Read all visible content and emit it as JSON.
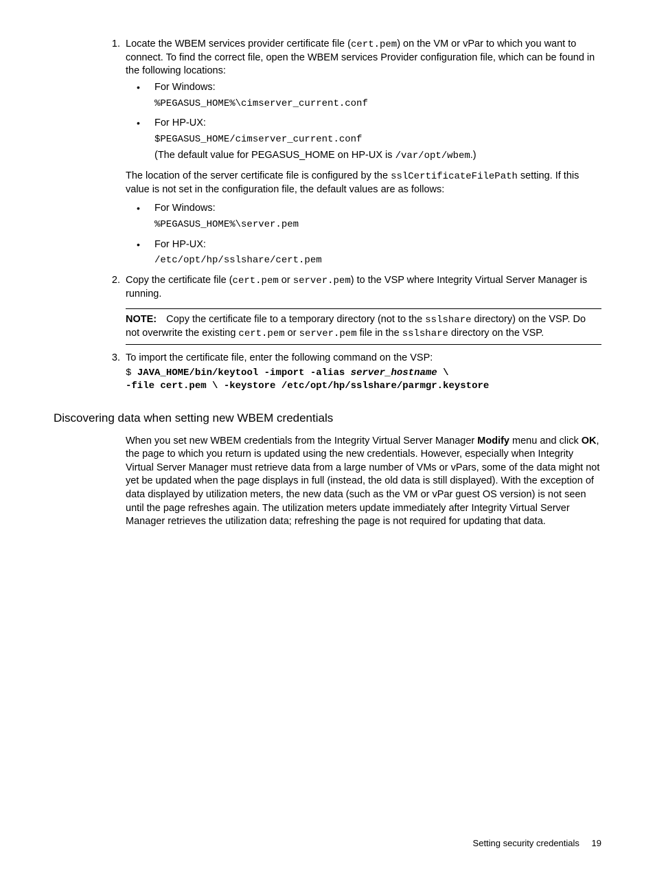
{
  "steps": {
    "s1": {
      "num": "1.",
      "intro_a": "Locate the WBEM services provider certificate file (",
      "intro_code1": "cert.pem",
      "intro_b": ") on the VM or vPar to which you want to connect. To find the correct file, open the WBEM services Provider configuration file, which can be found in the following locations:",
      "b1_label": "For Windows:",
      "b1_code": "%PEGASUS_HOME%\\cimserver_current.conf",
      "b2_label": "For HP-UX:",
      "b2_code": "$PEGASUS_HOME/cimserver_current.conf",
      "b2_extra_a": "(The default value for PEGASUS_HOME on HP-UX is ",
      "b2_extra_code": "/var/opt/wbem",
      "b2_extra_b": ".)",
      "mid_a": "The location of the server certificate file is configured by the ",
      "mid_code": "sslCertificateFilePath",
      "mid_b": " setting. If this value is not set in the configuration file, the default values are as follows:",
      "b3_label": "For Windows:",
      "b3_code": "%PEGASUS_HOME%\\server.pem",
      "b4_label": "For HP-UX:",
      "b4_code": "/etc/opt/hp/sslshare/cert.pem"
    },
    "s2": {
      "num": "2.",
      "intro_a": "Copy the certificate file (",
      "intro_code1": "cert.pem",
      "intro_mid": " or ",
      "intro_code2": "server.pem",
      "intro_b": ") to the VSP where Integrity Virtual Server Manager is running.",
      "note_label": "NOTE:",
      "note_a": "Copy the certificate file to a temporary directory (not to the ",
      "note_code1": "sslshare",
      "note_b": " directory) on the VSP. Do not overwrite the existing ",
      "note_code2": "cert.pem",
      "note_c": " or ",
      "note_code3": "server.pem",
      "note_d": " file in the ",
      "note_code4": "sslshare",
      "note_e": " directory on the VSP."
    },
    "s3": {
      "num": "3.",
      "intro": "To import the certificate file, enter the following command on the VSP:",
      "cmd_prompt": "$ ",
      "cmd_line1a": "JAVA_HOME/bin/keytool -import -alias ",
      "cmd_hostname": "server_hostname",
      "cmd_line1b": " \\",
      "cmd_line2": "-file cert.pem \\ -keystore /etc/opt/hp/sslshare/parmgr.keystore"
    }
  },
  "heading": "Discovering data when setting new WBEM credentials",
  "para2_a": "When you set new WBEM credentials from the Integrity Virtual Server Manager ",
  "para2_bold1": "Modify",
  "para2_b": " menu and click ",
  "para2_bold2": "OK",
  "para2_c": ", the page to which you return is updated using the new credentials. However, especially when Integrity Virtual Server Manager must retrieve data from a large number of VMs or vPars, some of the data might not yet be updated when the page displays in full (instead, the old data is still displayed). With the exception of data displayed by utilization meters, the new data (such as the VM or vPar guest OS version) is not seen until the page refreshes again. The utilization meters update immediately after Integrity Virtual Server Manager retrieves the utilization data; refreshing the page is not required for updating that data.",
  "footer_text": "Setting security credentials",
  "footer_page": "19"
}
